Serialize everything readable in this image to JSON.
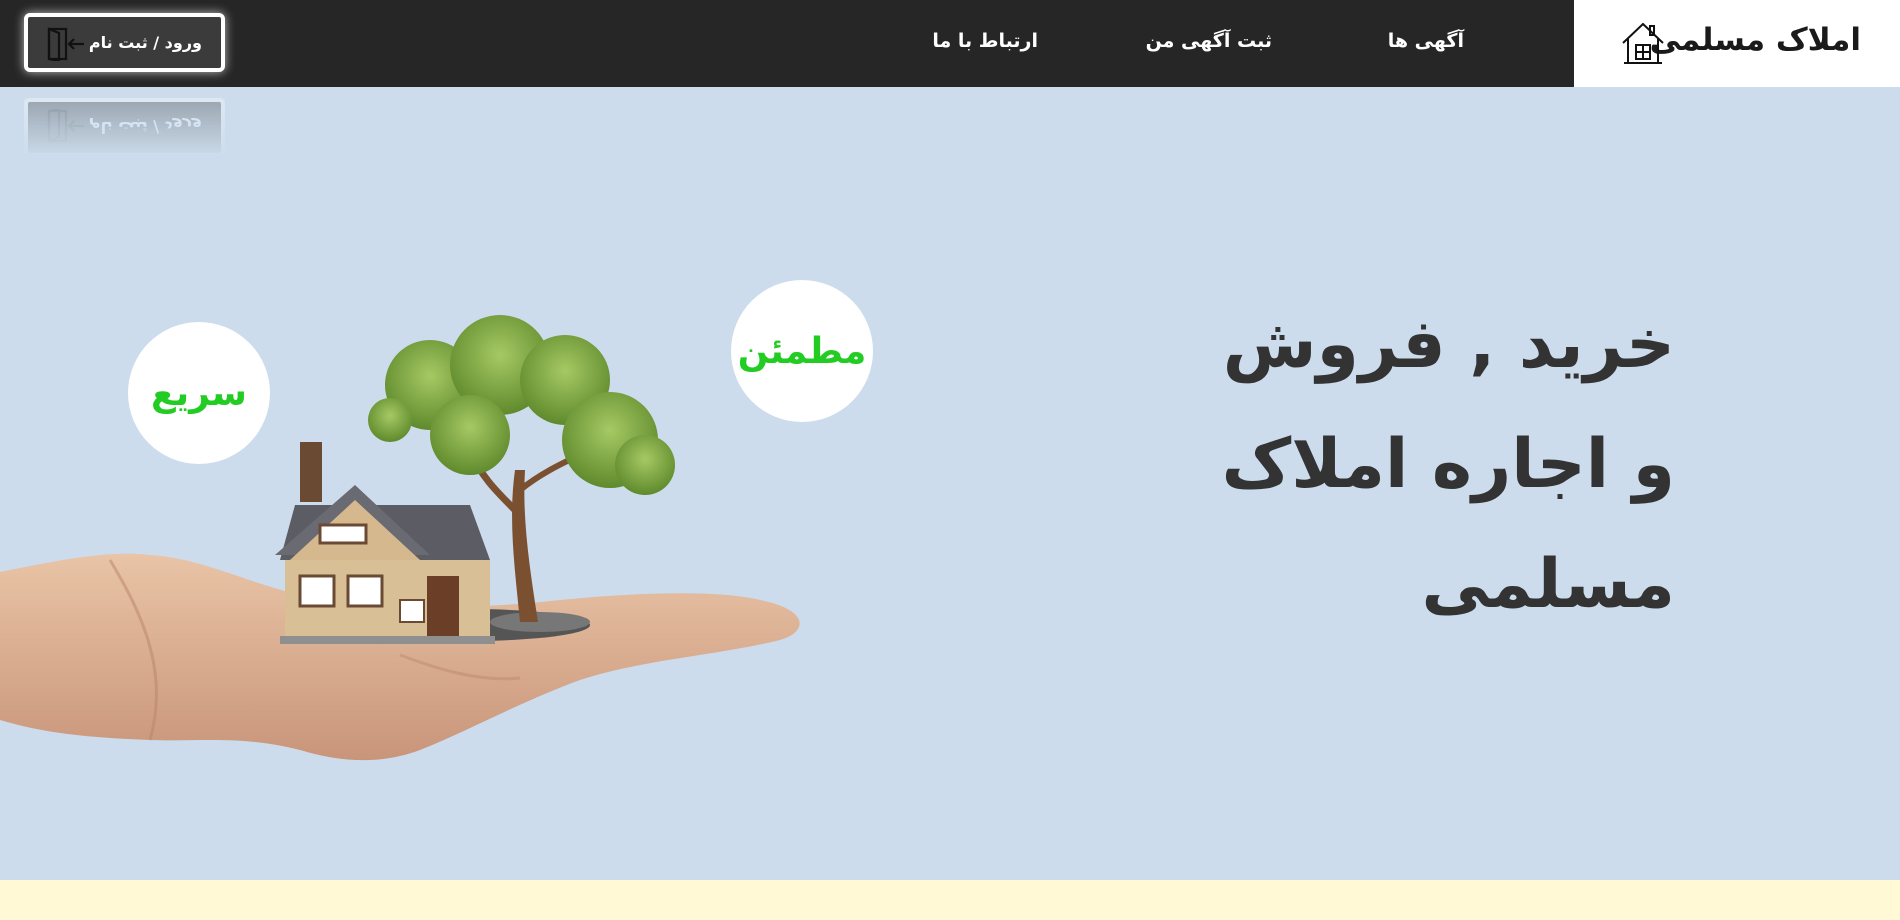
{
  "brand": {
    "name": "املاک مسلمی",
    "icon": "house-icon"
  },
  "nav": {
    "items": [
      {
        "label": "آگهی ها"
      },
      {
        "label": "ثبت آگهی من"
      },
      {
        "label": "ارتباط با ما"
      }
    ]
  },
  "login": {
    "label": "ورود / ثبت نام",
    "icon": "login-door-icon"
  },
  "hero": {
    "title_line1": "خرید , فروش",
    "title_line2": "و اجاره املاک",
    "title_line3": "مسلمی",
    "badges": [
      {
        "label": "سریع"
      },
      {
        "label": "مطمئن"
      }
    ],
    "illustration": "hand-holding-house-and-tree"
  },
  "colors": {
    "header_bg": "#262626",
    "hero_bg": "#ccdcec",
    "badge_text": "#22cc22",
    "title_text": "#333333",
    "bottom_band": "#fff9d6"
  }
}
